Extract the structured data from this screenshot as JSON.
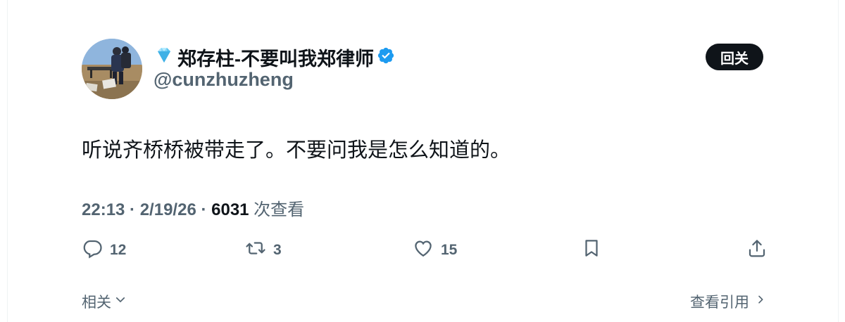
{
  "author": {
    "display_name": "郑存柱-不要叫我郑律师",
    "handle": "@cunzhuzheng",
    "prefix_icon": "diamond-icon",
    "verified_icon": "verified-badge-icon"
  },
  "follow_button": {
    "label": "回关"
  },
  "tweet": {
    "text": "听说齐桥桥被带走了。不要问我是怎么知道的。"
  },
  "meta": {
    "timestamp": "22:13 · 2/19/26 · ",
    "views_count": "6031",
    "views_label": " 次查看"
  },
  "actions": {
    "reply": {
      "icon": "reply-icon",
      "count": "12"
    },
    "retweet": {
      "icon": "retweet-icon",
      "count": "3"
    },
    "like": {
      "icon": "heart-icon",
      "count": "15"
    },
    "bookmark": {
      "icon": "bookmark-icon"
    },
    "share": {
      "icon": "share-icon"
    }
  },
  "footer": {
    "related_label": "相关",
    "quotes_label": "查看引用"
  },
  "colors": {
    "text_primary": "#0f1419",
    "text_secondary": "#536471",
    "verified": "#1d9bf0",
    "button_bg": "#0f1419"
  }
}
